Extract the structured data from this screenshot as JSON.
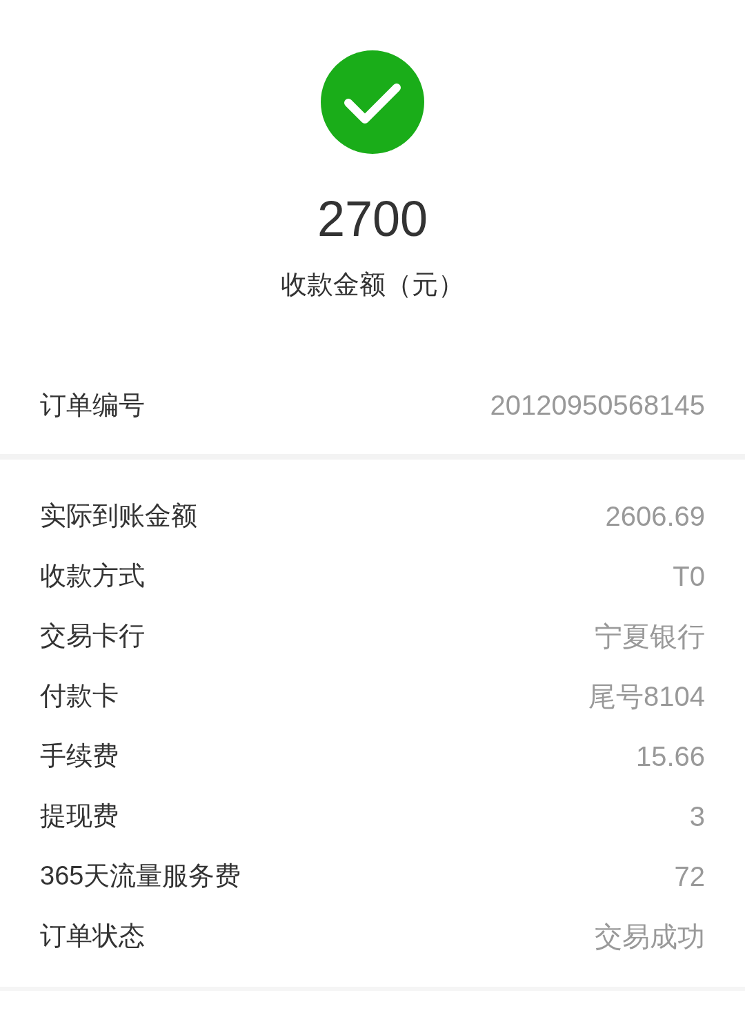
{
  "amount": "2700",
  "amount_label": "收款金额（元）",
  "order": {
    "label": "订单编号",
    "value": "20120950568145"
  },
  "details": [
    {
      "label": "实际到账金额",
      "value": "2606.69"
    },
    {
      "label": "收款方式",
      "value": "T0"
    },
    {
      "label": "交易卡行",
      "value": "宁夏银行"
    },
    {
      "label": "付款卡",
      "value": "尾号8104"
    },
    {
      "label": "手续费",
      "value": "15.66"
    },
    {
      "label": "提现费",
      "value": "3"
    },
    {
      "label": "365天流量服务费",
      "value": "72"
    },
    {
      "label": "订单状态",
      "value": "交易成功"
    }
  ]
}
